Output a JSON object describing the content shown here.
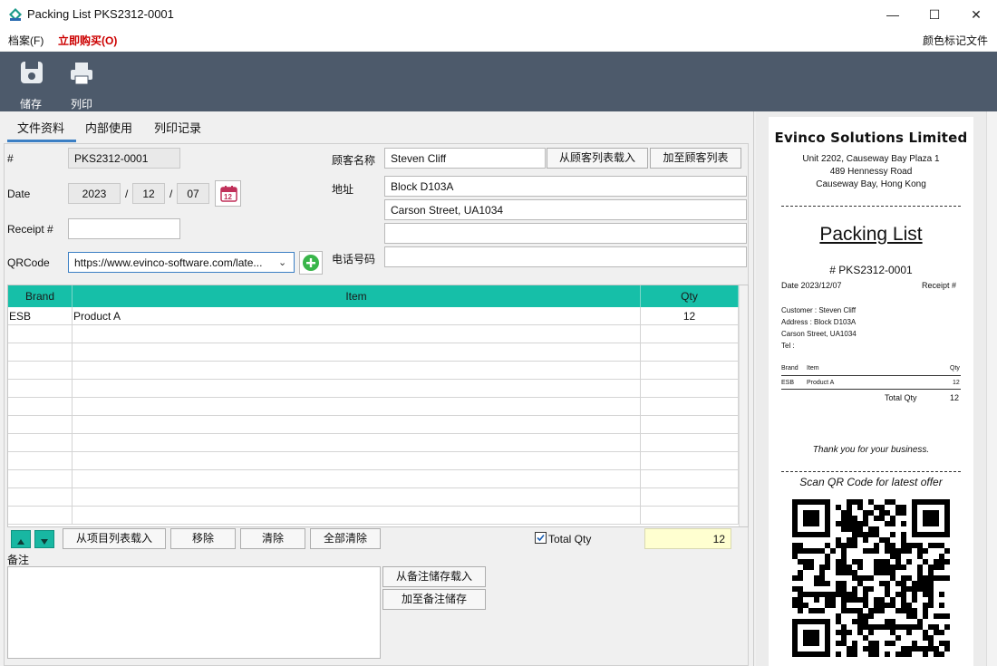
{
  "window": {
    "title": "Packing List PKS2312-0001",
    "minimize": "—",
    "maximize": "☐",
    "close": "✕"
  },
  "menu": {
    "file": "档案(F)",
    "buy": "立即购买(O)",
    "color_tag": "颜色标记文件"
  },
  "toolbar": {
    "save": "储存",
    "print": "列印"
  },
  "tabs": [
    "文件资料",
    "内部使用",
    "列印记录"
  ],
  "form": {
    "number_label": "#",
    "number": "PKS2312-0001",
    "date_label": "Date",
    "date_year": "2023",
    "date_month": "12",
    "date_day": "07",
    "date_sep": "/",
    "calendar_day": "12",
    "receipt_label": "Receipt #",
    "receipt": "",
    "qrcode_label": "QRCode",
    "qrcode": "https://www.evinco-software.com/late...",
    "customer_label": "顾客名称",
    "customer": "Steven Cliff",
    "load_customer": "从顾客列表载入",
    "add_customer": "加至顾客列表",
    "address_label": "地址",
    "address1": "Block D103A",
    "address2": "Carson Street, UA1034",
    "address3": "",
    "phone_label": "电话号码",
    "phone": ""
  },
  "grid": {
    "headers": [
      "Brand",
      "Item",
      "Qty"
    ],
    "rows": [
      [
        "ESB",
        "Product A",
        "12"
      ],
      [
        "",
        "",
        ""
      ],
      [
        "",
        "",
        ""
      ],
      [
        "",
        "",
        ""
      ],
      [
        "",
        "",
        ""
      ],
      [
        "",
        "",
        ""
      ],
      [
        "",
        "",
        ""
      ],
      [
        "",
        "",
        ""
      ],
      [
        "",
        "",
        ""
      ],
      [
        "",
        "",
        ""
      ],
      [
        "",
        "",
        ""
      ],
      [
        "",
        "",
        ""
      ]
    ]
  },
  "actions": {
    "load_items": "从项目列表载入",
    "remove": "移除",
    "clear": "清除",
    "clear_all": "全部清除",
    "total_qty_label": "Total Qty",
    "total_qty_checked": true,
    "total_qty": "12"
  },
  "notes": {
    "label": "备注",
    "value": "",
    "load": "从备注储存载入",
    "save": "加至备注储存"
  },
  "preview": {
    "company": "Evinco Solutions Limited",
    "addr1": "Unit 2202, Causeway Bay Plaza 1",
    "addr2": "489 Hennessy Road",
    "addr3": "Causeway Bay, Hong Kong",
    "doc_title": "Packing List",
    "number": "# PKS2312-0001",
    "date": "Date 2023/12/07",
    "receipt": "Receipt #",
    "customer": "Customer : Steven Cliff",
    "address1": "Address : Block D103A",
    "address2": "Carson Street, UA1034",
    "tel": "Tel :",
    "col_brand": "Brand",
    "col_item": "Item",
    "col_qty": "Qty",
    "row_brand": "ESB",
    "row_item": "Product A",
    "row_qty": "12",
    "total_label": "Total Qty",
    "total": "12",
    "thanks": "Thank you for your business.",
    "scan": "Scan QR Code for latest offer"
  },
  "colors": {
    "toolbar_bg": "#4d5a6b",
    "grid_header": "#16bfa8",
    "accent_tab": "#3b7fc4",
    "buy_red": "#cc0000",
    "total_bg": "#ffffd0"
  }
}
